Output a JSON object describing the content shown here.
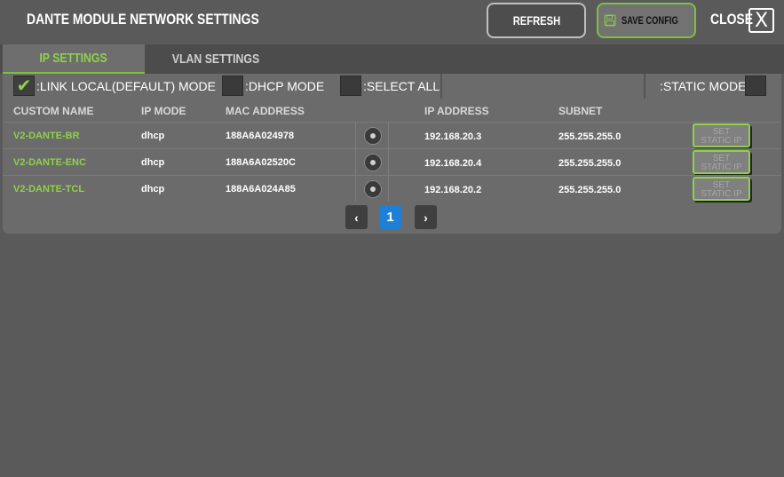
{
  "header": {
    "title": "DANTE MODULE NETWORK SETTINGS",
    "refresh_label": "REFRESH",
    "save_label": "SAVE CONFIG",
    "close_label": "CLOSE",
    "close_icon_glyph": "X"
  },
  "tabs": [
    {
      "label": "IP SETTINGS",
      "active": true
    },
    {
      "label": "VLAN SETTINGS",
      "active": false
    }
  ],
  "modes": {
    "link_local": {
      "label": ":LINK LOCAL(DEFAULT) MODE",
      "checked": true
    },
    "dhcp": {
      "label": ":DHCP MODE",
      "checked": false
    },
    "select_all": {
      "label": ":SELECT ALL",
      "checked": false
    },
    "static": {
      "label": ":STATIC MODE:",
      "checked": false
    }
  },
  "table": {
    "columns": [
      "CUSTOM NAME",
      "IP MODE",
      "MAC ADDRESS",
      "IP ADDRESS",
      "SUBNET"
    ],
    "rows": [
      {
        "name": "V2-DANTE-BR",
        "ip_mode": "dhcp",
        "mac": "188A6A024978",
        "ip": "192.168.20.3",
        "subnet": "255.255.255.0",
        "action_line1": "SET",
        "action_line2": "STATIC IP"
      },
      {
        "name": "V2-DANTE-ENC",
        "ip_mode": "dhcp",
        "mac": "188A6A02520C",
        "ip": "192.168.20.4",
        "subnet": "255.255.255.0",
        "action_line1": "SET",
        "action_line2": "STATIC IP"
      },
      {
        "name": "V2-DANTE-TCL",
        "ip_mode": "dhcp",
        "mac": "188A6A024A85",
        "ip": "192.168.20.2",
        "subnet": "255.255.255.0",
        "action_line1": "SET",
        "action_line2": "STATIC IP"
      }
    ]
  },
  "pagination": {
    "prev": "‹",
    "current": "1",
    "next": "›"
  },
  "colors": {
    "accent_green": "#8fd14a",
    "page_blue": "#1e7fd6",
    "background": "#5a5a5a"
  },
  "icons": {
    "save": "floppy-disk-icon",
    "close": "close-icon",
    "prev": "chevron-left-icon",
    "next": "chevron-right-icon",
    "check": "checkmark-icon"
  }
}
